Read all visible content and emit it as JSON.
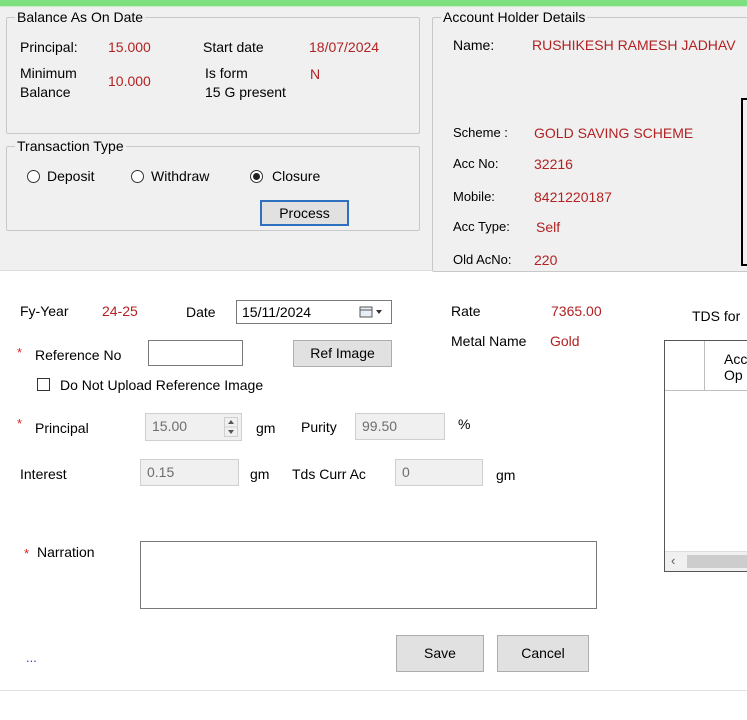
{
  "balance": {
    "legend": "Balance As On Date",
    "principal_label": "Principal:",
    "principal_value": "15.000",
    "start_date_label": "Start date",
    "start_date_value": "18/07/2024",
    "min_balance_label_1": "Minimum",
    "min_balance_label_2": "Balance",
    "min_balance_value": "10.000",
    "form15g_label_1": "Is form",
    "form15g_label_2": "15 G present",
    "form15g_value": "N"
  },
  "transaction": {
    "legend": "Transaction Type",
    "options": [
      {
        "label": "Deposit",
        "selected": false
      },
      {
        "label": "Withdraw",
        "selected": false
      },
      {
        "label": "Closure",
        "selected": true
      }
    ],
    "process_label": "Process"
  },
  "account": {
    "legend": "Account Holder Details",
    "name_label": "Name:",
    "name_value": "RUSHIKESH RAMESH JADHAV",
    "scheme_label": "Scheme :",
    "scheme_value": "GOLD SAVING SCHEME",
    "accno_label": "Acc No:",
    "accno_value": "32216",
    "mobile_label": "Mobile:",
    "mobile_value": "8421220187",
    "acctype_label": "Acc Type:",
    "acctype_value": "Self",
    "oldacno_label": "Old AcNo:",
    "oldacno_value": "220"
  },
  "form": {
    "fy_label": "Fy-Year",
    "fy_value": "24-25",
    "date_label": "Date",
    "date_value": "15/11/2024",
    "rate_label": "Rate",
    "rate_value": "7365.00",
    "metal_label": "Metal Name",
    "metal_value": "Gold",
    "reference_label": "Reference No",
    "reference_value": "",
    "ref_image_label": "Ref Image",
    "no_upload_label": "Do Not Upload Reference Image",
    "principal_label": "Principal",
    "principal_value": "15.00",
    "unit_gm": "gm",
    "purity_label": "Purity",
    "purity_value": "99.50",
    "percent": "%",
    "interest_label": "Interest",
    "interest_value": "0.15",
    "tds_label": "Tds Curr Ac",
    "tds_value": "0",
    "narration_label": "Narration",
    "narration_value": "",
    "save_label": "Save",
    "cancel_label": "Cancel",
    "ellipsis": "...",
    "required_mark": "*"
  },
  "tds_panel": {
    "title": "TDS for",
    "col_header_1": "Acc",
    "col_header_2": "Op"
  },
  "colors": {
    "value_red": "#b22222",
    "top_green": "#7fe07f",
    "focus_blue": "#2f6fc0"
  }
}
